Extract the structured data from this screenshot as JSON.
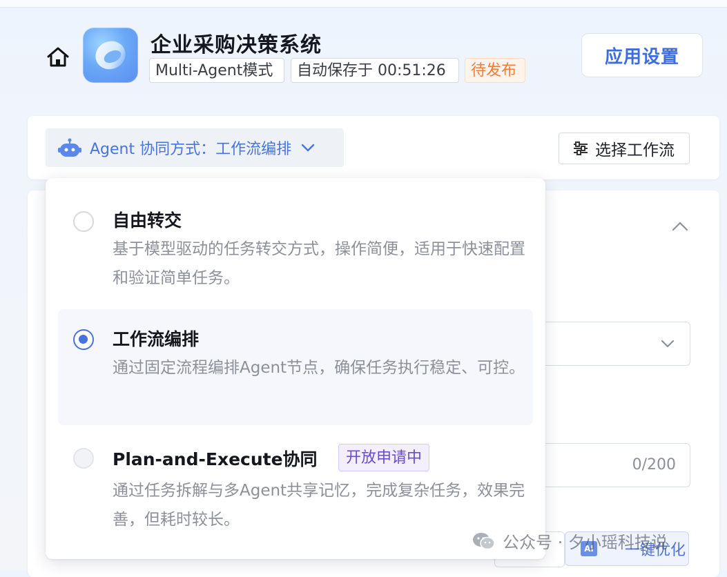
{
  "header": {
    "app_title": "企业采购决策系统",
    "mode_tag": "Multi-Agent模式",
    "autosave_tag": "自动保存于 00:51:26",
    "status_tag": "待发布",
    "settings_button": "应用设置"
  },
  "toolbar": {
    "agent_mode_label": "Agent 协同方式：工作流编排",
    "select_workflow_button": "选择工作流"
  },
  "dropdown": {
    "options": [
      {
        "title": "自由转交",
        "desc": "基于模型驱动的任务转交方式，操作简便，适用于快速配置和验证简单任务。",
        "checked": false
      },
      {
        "title": "工作流编排",
        "desc": "通过固定流程编排Agent节点，确保任务执行稳定、可控。",
        "checked": true
      },
      {
        "title": "Plan-and-Execute协同",
        "badge": "开放申请中",
        "desc": "通过任务拆解与多Agent共享记忆，完成复杂任务，效果完善，但耗时较长。",
        "checked": false,
        "disabled": true
      }
    ]
  },
  "background_form": {
    "char_count": "0/200",
    "optimize_button": "一键优化"
  },
  "watermark": {
    "text": "公众号 · 夕小瑶科技说"
  },
  "icons": {
    "home": "home-icon",
    "bot": "robot-icon",
    "chevron": "chevron-down-icon",
    "sliders": "sliders-icon",
    "collapse": "chevron-up-icon",
    "wechat": "wechat-icon"
  },
  "colors": {
    "accent": "#4672de",
    "status_orange": "#f27d3a",
    "badge_purple": "#6b4ad7"
  }
}
